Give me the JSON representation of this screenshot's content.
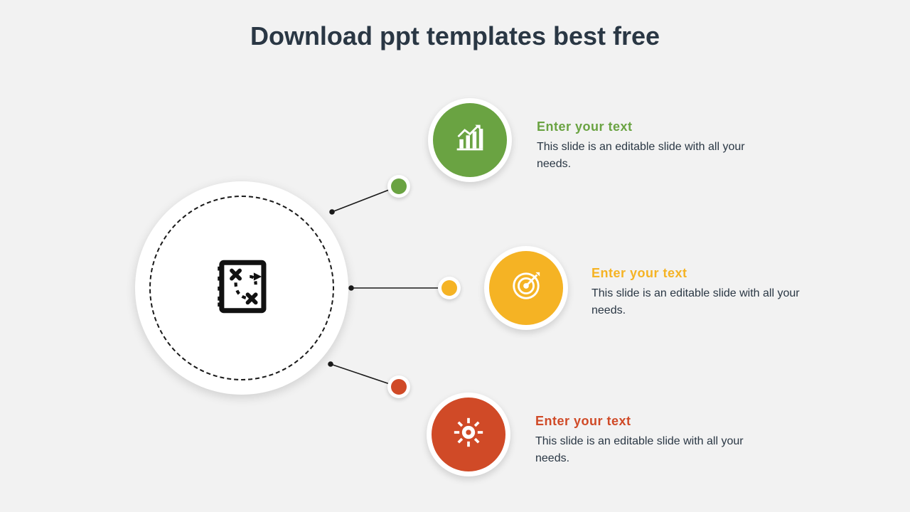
{
  "title": "Download ppt templates best free",
  "colors": {
    "green": "#6aa342",
    "yellow": "#f5b324",
    "orange": "#d04a27",
    "text": "#2a3744"
  },
  "hub": {
    "icon_name": "strategy-playbook-icon"
  },
  "nodes": [
    {
      "id": "chart",
      "icon_name": "bar-chart-arrow-icon",
      "title": "Enter your text",
      "desc": "This slide is an editable slide with all your needs.",
      "color_key": "green"
    },
    {
      "id": "target",
      "icon_name": "target-icon",
      "title": "Enter your text",
      "desc": "This slide is an editable slide with all your needs.",
      "color_key": "yellow"
    },
    {
      "id": "gear",
      "icon_name": "gear-icon",
      "title": "Enter your text",
      "desc": "This slide is an editable slide with all your needs.",
      "color_key": "orange"
    }
  ]
}
